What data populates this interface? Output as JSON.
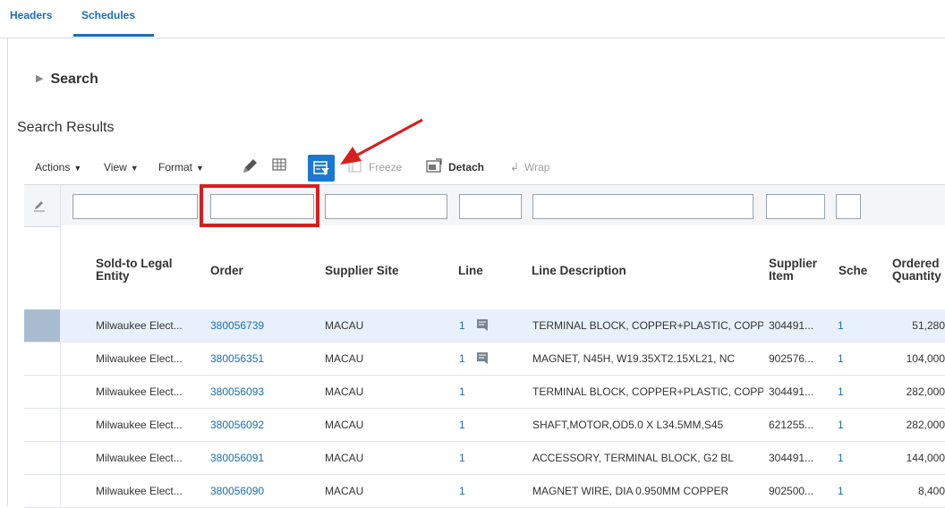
{
  "tabs": [
    {
      "label": "Headers"
    },
    {
      "label": "Schedules"
    }
  ],
  "search": {
    "label": "Search"
  },
  "results_title": "Search Results",
  "toolbar": {
    "actions": "Actions",
    "view": "View",
    "format": "Format",
    "freeze": "Freeze",
    "detach": "Detach",
    "wrap": "Wrap"
  },
  "columns": {
    "sold_to": "Sold-to Legal Entity",
    "order": "Order",
    "supplier_site": "Supplier Site",
    "line": "Line",
    "line_description": "Line Description",
    "supplier_item": "Supplier Item",
    "schedule": "Sche",
    "ordered_quantity": "Ordered Quantity"
  },
  "rows": [
    {
      "sold_to": "Milwaukee Elect...",
      "order": "380056739",
      "site": "MACAU",
      "line": "1",
      "desc": "TERMINAL BLOCK, COPPER+PLASTIC, COPPE",
      "item": "304491...",
      "sched": "1",
      "qty": "51,280",
      "has_note": true,
      "selected": true
    },
    {
      "sold_to": "Milwaukee Elect...",
      "order": "380056351",
      "site": "MACAU",
      "line": "1",
      "desc": "MAGNET, N45H, W19.35XT2.15XL21, NC",
      "item": "902576...",
      "sched": "1",
      "qty": "104,000",
      "has_note": true,
      "selected": false
    },
    {
      "sold_to": "Milwaukee Elect...",
      "order": "380056093",
      "site": "MACAU",
      "line": "1",
      "desc": "TERMINAL BLOCK, COPPER+PLASTIC, COPPE",
      "item": "304491...",
      "sched": "1",
      "qty": "282,000",
      "has_note": false,
      "selected": false
    },
    {
      "sold_to": "Milwaukee Elect...",
      "order": "380056092",
      "site": "MACAU",
      "line": "1",
      "desc": "SHAFT,MOTOR,OD5.0 X L34.5MM,S45",
      "item": "621255...",
      "sched": "1",
      "qty": "282,000",
      "has_note": false,
      "selected": false
    },
    {
      "sold_to": "Milwaukee Elect...",
      "order": "380056091",
      "site": "MACAU",
      "line": "1",
      "desc": "ACCESSORY, TERMINAL BLOCK, G2 BL",
      "item": "304491...",
      "sched": "1",
      "qty": "144,000",
      "has_note": false,
      "selected": false
    },
    {
      "sold_to": "Milwaukee Elect...",
      "order": "380056090",
      "site": "MACAU",
      "line": "1",
      "desc": "MAGNET WIRE, DIA 0.950MM COPPER",
      "item": "902500...",
      "sched": "1",
      "qty": "8,400",
      "has_note": false,
      "selected": false
    }
  ],
  "colors": {
    "accent": "#1a6fb3",
    "highlight": "#d81e1e",
    "qbe_button": "#1a78d0"
  }
}
